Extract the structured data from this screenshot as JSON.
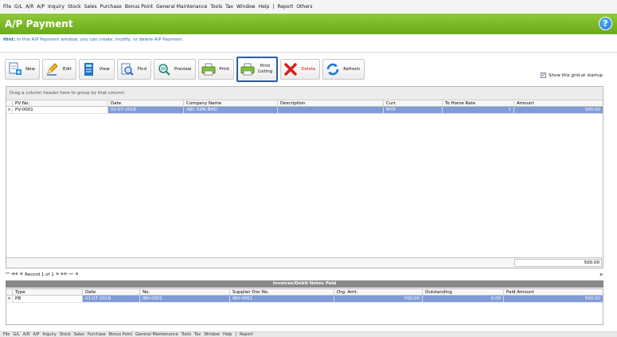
{
  "menu": {
    "items": [
      "File",
      "G/L",
      "A/R",
      "A/P",
      "Inquiry",
      "Stock",
      "Sales",
      "Purchase",
      "Bonus Point",
      "General Maintenance",
      "Tools",
      "Tax",
      "Window",
      "Help",
      "|",
      "Report",
      "Others"
    ]
  },
  "window": {
    "title": "A/P Payment",
    "help_icon": "?",
    "hint_label": "Hint:",
    "hint_text": "In this A/P Payment window, you can create, modify, or delete A/P Payment."
  },
  "toolbar": {
    "new": "New",
    "edit": "Edit",
    "view": "View",
    "find": "Find",
    "preview": "Preview",
    "print": "Print",
    "print_listing_1": "Print",
    "print_listing_2": "Listing",
    "delete": "Delete",
    "refresh": "Refresh",
    "show_grid": "Show this grid at startup",
    "show_grid_checked": "✓"
  },
  "grid": {
    "group_hint": "Drag a column header here to group by that column",
    "columns": [
      "PV No.",
      "Date",
      "Company Name",
      "Description",
      "Curr.",
      "To Home Rate",
      "Amount"
    ],
    "rows": [
      {
        "indicator": ">",
        "pv_no": "PV-0001",
        "date": "02-07-2018",
        "company": "ABC SDN BHD",
        "description": "",
        "curr": "MYR",
        "rate": "1",
        "amount": "500.00"
      }
    ],
    "total": "500.00"
  },
  "navigator": {
    "left_glyphs": "⏮ ◀◀ ◀",
    "record": "Record 1 of 1",
    "right_glyphs": "▶ ▶▶ ⏭ ◀",
    "scroll_right": "▶"
  },
  "invoices": {
    "title": "Invoices/Debit Notes Paid",
    "columns": [
      "Type",
      "Date",
      "No.",
      "Supplier Doc No.",
      "Org. Amt.",
      "Outstanding",
      "Paid Amount"
    ],
    "rows": [
      {
        "indicator": ">",
        "type": "PB",
        "date": "01-07-2018",
        "no": "INV-0001",
        "supplier_doc": "INV-0001",
        "org_amt": "500.00",
        "outstanding": "0.00",
        "paid": "500.00"
      }
    ]
  },
  "colors": {
    "title_green": "#7ab72a",
    "hint_blue": "#2a6db5",
    "selection_blue": "#7f9bd8",
    "delete_red": "#d02020",
    "paid_bar_gray": "#888a8c"
  }
}
